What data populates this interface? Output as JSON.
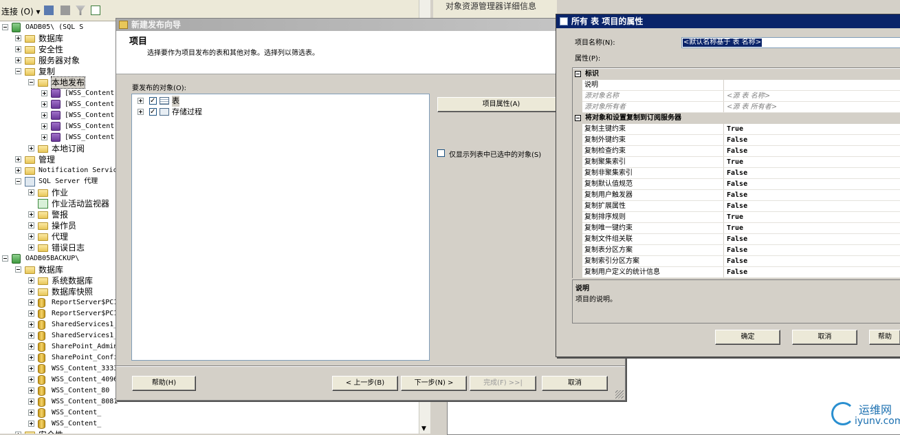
{
  "explorer": {
    "toolbar_label": "连接 (O) ▾",
    "tree": [
      {
        "label": "OADB05\\          (SQL S",
        "kind": "server",
        "state": "minus",
        "mono": true
      },
      {
        "label": "数据库",
        "kind": "folder",
        "state": "plus"
      },
      {
        "label": "安全性",
        "kind": "folder",
        "state": "plus"
      },
      {
        "label": "服务器对象",
        "kind": "folder",
        "state": "plus"
      },
      {
        "label": "复制",
        "kind": "folder",
        "state": "minus"
      },
      {
        "label": "本地发布",
        "kind": "folder",
        "state": "minus",
        "selected": true
      },
      {
        "label": "[WSS_Content",
        "kind": "pub",
        "state": "plus",
        "mono": true
      },
      {
        "label": "[WSS_Content",
        "kind": "pub",
        "state": "plus",
        "mono": true
      },
      {
        "label": "[WSS_Content",
        "kind": "pub",
        "state": "plus",
        "mono": true
      },
      {
        "label": "[WSS_Content",
        "kind": "pub",
        "state": "plus",
        "mono": true
      },
      {
        "label": "[WSS_Content",
        "kind": "pub",
        "state": "plus",
        "mono": true
      },
      {
        "label": "本地订阅",
        "kind": "folder",
        "state": "plus"
      },
      {
        "label": "管理",
        "kind": "folder",
        "state": "plus"
      },
      {
        "label": "Notification Servic",
        "kind": "folder",
        "state": "plus",
        "mono": true
      },
      {
        "label": "SQL Server 代理",
        "kind": "agent",
        "state": "minus",
        "mono": true
      },
      {
        "label": "作业",
        "kind": "folder",
        "state": "plus"
      },
      {
        "label": "作业活动监视器",
        "kind": "monitor",
        "state": "none"
      },
      {
        "label": "警报",
        "kind": "folder",
        "state": "plus"
      },
      {
        "label": "操作员",
        "kind": "folder",
        "state": "plus"
      },
      {
        "label": "代理",
        "kind": "folder",
        "state": "plus"
      },
      {
        "label": "错误日志",
        "kind": "folder",
        "state": "plus"
      },
      {
        "label": "OADB05BACKUP\\",
        "kind": "server",
        "state": "minus",
        "mono": true
      },
      {
        "label": "数据库",
        "kind": "folder",
        "state": "minus"
      },
      {
        "label": "系统数据库",
        "kind": "folder",
        "state": "plus"
      },
      {
        "label": "数据库快照",
        "kind": "folder",
        "state": "plus"
      },
      {
        "label": "ReportServer$PC1",
        "kind": "db",
        "state": "plus",
        "mono": true
      },
      {
        "label": "ReportServer$PC1",
        "kind": "db",
        "state": "plus",
        "mono": true
      },
      {
        "label": "SharedServices1_",
        "kind": "db",
        "state": "plus",
        "mono": true
      },
      {
        "label": "SharedServices1_",
        "kind": "db",
        "state": "plus",
        "mono": true
      },
      {
        "label": "SharePoint_Admin",
        "kind": "db",
        "state": "plus",
        "mono": true
      },
      {
        "label": "SharePoint_Confi",
        "kind": "db",
        "state": "plus",
        "mono": true
      },
      {
        "label": "WSS_Content_3333",
        "kind": "db",
        "state": "plus",
        "mono": true
      },
      {
        "label": "WSS_Content_4096",
        "kind": "db",
        "state": "plus",
        "mono": true
      },
      {
        "label": "WSS_Content_80",
        "kind": "db",
        "state": "plus",
        "mono": true
      },
      {
        "label": "WSS_Content_8081",
        "kind": "db",
        "state": "plus",
        "mono": true
      },
      {
        "label": "WSS_Content_",
        "kind": "db",
        "state": "plus",
        "mono": true
      },
      {
        "label": "WSS_Content_",
        "kind": "db",
        "state": "plus",
        "mono": true
      },
      {
        "label": "安全性",
        "kind": "folder",
        "state": "plus"
      }
    ]
  },
  "background": {
    "header_text": "对象资源管理器详细信息"
  },
  "wizard": {
    "title": "新建发布向导",
    "heading": "项目",
    "subheading": "选择要作为项目发布的表和其他对象。选择列以筛选表。",
    "objects_label": "要发布的对象(O):",
    "objects": [
      {
        "label": "表",
        "checked": true,
        "icon": "table-icon"
      },
      {
        "label": "存储过程",
        "checked": true,
        "icon": "stored-procedure-icon"
      }
    ],
    "article_props_button": "项目属性(A)",
    "show_only_checked_label": "仅显示列表中已选中的对象(S)",
    "help_button": "帮助(H)",
    "back_button": "< 上一步(B)",
    "next_button": "下一步(N) >",
    "finish_button": "完成(F) >>|",
    "cancel_button": "取消"
  },
  "props": {
    "title": "所有 表 项目的属性",
    "name_label": "项目名称(N):",
    "name_value": "<默认名称基于 表 名称>",
    "attr_label": "属性(P):",
    "categories": [
      {
        "name": "标识",
        "rows": [
          {
            "key": "说明",
            "value": "",
            "disabled": false
          },
          {
            "key": "源对象名称",
            "value": "<源 表 名称>",
            "disabled": true
          },
          {
            "key": "源对象所有者",
            "value": "<源 表 所有者>",
            "disabled": true
          }
        ]
      },
      {
        "name": "将对象和设置复制到订阅服务器",
        "rows": [
          {
            "key": "复制主键约束",
            "value": "True"
          },
          {
            "key": "复制外键约束",
            "value": "False"
          },
          {
            "key": "复制检查约束",
            "value": "False"
          },
          {
            "key": "复制聚集索引",
            "value": "True"
          },
          {
            "key": "复制非聚集索引",
            "value": "False"
          },
          {
            "key": "复制默认值规范",
            "value": "False"
          },
          {
            "key": "复制用户触发器",
            "value": "False"
          },
          {
            "key": "复制扩展属性",
            "value": "False"
          },
          {
            "key": "复制排序规则",
            "value": "True"
          },
          {
            "key": "复制唯一键约束",
            "value": "True"
          },
          {
            "key": "复制文件组关联",
            "value": "False"
          },
          {
            "key": "复制表分区方案",
            "value": "False"
          },
          {
            "key": "复制索引分区方案",
            "value": "False"
          },
          {
            "key": "复制用户定义的统计信息",
            "value": "False"
          }
        ]
      }
    ],
    "desc_title": "说明",
    "desc_text": "项目的说明。",
    "ok_button": "确定",
    "cancel_button": "取消",
    "help_button": "帮助"
  },
  "watermark": {
    "line1": "运维网",
    "line2": "iyunv.com"
  }
}
